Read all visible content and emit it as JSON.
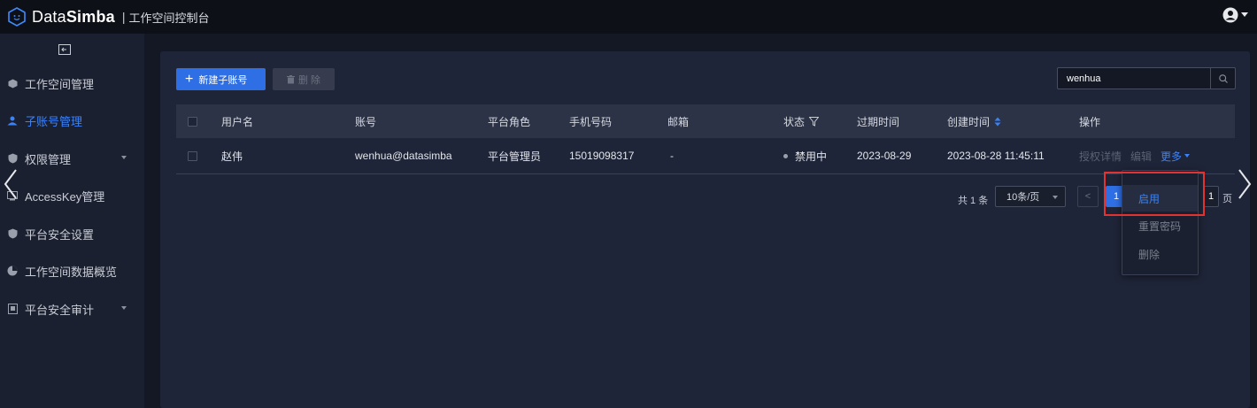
{
  "app": {
    "brand_left": "Data",
    "brand_right": "Simba",
    "separator": "|",
    "subtitle": "工作空间控制台"
  },
  "sidebar": {
    "items": [
      {
        "label": "工作空间管理",
        "icon": "cube-icon",
        "active": false,
        "has_caret": false
      },
      {
        "label": "子账号管理",
        "icon": "user-group-icon",
        "active": true,
        "has_caret": false
      },
      {
        "label": "权限管理",
        "icon": "shield-icon",
        "active": false,
        "has_caret": true
      },
      {
        "label": "AccessKey管理",
        "icon": "key-icon",
        "active": false,
        "has_caret": false
      },
      {
        "label": "平台安全设置",
        "icon": "shield-check-icon",
        "active": false,
        "has_caret": false
      },
      {
        "label": "工作空间数据概览",
        "icon": "pie-chart-icon",
        "active": false,
        "has_caret": false
      },
      {
        "label": "平台安全审计",
        "icon": "audit-icon",
        "active": false,
        "has_caret": true
      }
    ]
  },
  "toolbar": {
    "new_label": "新建子账号",
    "delete_label": "删 除",
    "search_value": "wenhua"
  },
  "table": {
    "columns": [
      "用户名",
      "账号",
      "平台角色",
      "手机号码",
      "邮箱",
      "状态",
      "过期时间",
      "创建时间",
      "操作"
    ],
    "rows": [
      {
        "username": "赵伟",
        "account": "wenhua@datasimba",
        "role": "平台管理员",
        "phone": "15019098317",
        "email": "-",
        "status": "禁用中",
        "expire": "2023-08-29",
        "created": "2023-08-28 11:45:11",
        "ops": {
          "detail": "授权详情",
          "edit": "编辑",
          "more": "更多"
        }
      }
    ]
  },
  "pager": {
    "total": "共 1 条",
    "page_size": "10条/页",
    "prev": "<",
    "current": "1",
    "jump_value": "1",
    "jump_suffix": "页"
  },
  "more_menu": {
    "items": [
      "启用",
      "重置密码",
      "删除"
    ]
  },
  "colors": {
    "accent": "#2f6fe6",
    "link": "#3b82f6",
    "highlight": "#e3322f"
  }
}
